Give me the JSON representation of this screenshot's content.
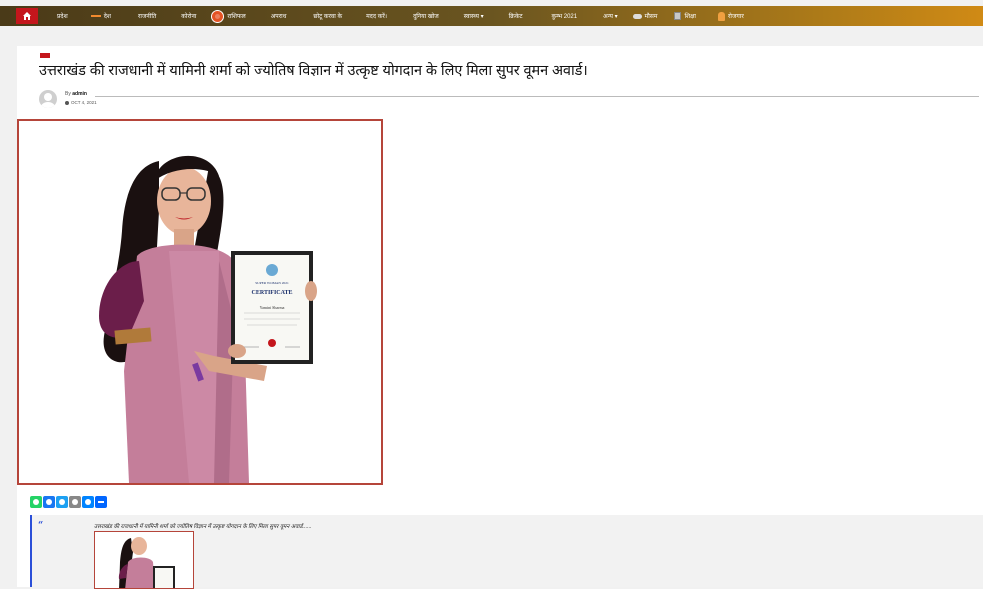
{
  "nav": {
    "home_icon": "home-icon",
    "items": [
      {
        "label": "प्रदेश",
        "icon": ""
      },
      {
        "label": "देश",
        "icon": "line"
      },
      {
        "label": "राजनीति",
        "icon": ""
      },
      {
        "label": "कोरोना",
        "icon": ""
      },
      {
        "label": "राशिफल",
        "icon": "zodiac-icon"
      },
      {
        "label": "अपराध",
        "icon": ""
      },
      {
        "label": "छोटू करवा के",
        "icon": ""
      },
      {
        "label": "मदद करें।",
        "icon": ""
      },
      {
        "label": "दुनिया खोज",
        "icon": ""
      },
      {
        "label": "स्वास्थ्य ▾",
        "icon": ""
      },
      {
        "label": "क्रिकेट",
        "icon": ""
      },
      {
        "label": "कुम्भ 2021",
        "icon": ""
      },
      {
        "label": "अन्य ▾",
        "icon": ""
      },
      {
        "label": "मौसम",
        "icon": "cloud-icon"
      },
      {
        "label": "शिक्षा",
        "icon": "book-icon"
      },
      {
        "label": "रोजगार",
        "icon": "person-icon"
      }
    ]
  },
  "article": {
    "title": "उत्तराखंड की राजधानी में यामिनी शर्मा को ज्योतिष विज्ञान में उत्कृष्ट योगदान के लिए मिला सुपर वूमन अवार्ड।",
    "by_label": "By",
    "author": "admin",
    "date": "OCT 4, 2021"
  },
  "certificate": {
    "header": "SUPER WOMAN 2021",
    "title": "CERTIFICATE",
    "name": "Yamini Sharma"
  },
  "share": {
    "buttons": [
      {
        "name": "whatsapp",
        "color": "#25d366"
      },
      {
        "name": "facebook",
        "color": "#1877f2"
      },
      {
        "name": "twitter",
        "color": "#1da1f2"
      },
      {
        "name": "email",
        "color": "#888888"
      },
      {
        "name": "messenger",
        "color": "#0084ff"
      },
      {
        "name": "share",
        "color": "#0166ff"
      }
    ]
  },
  "quote": {
    "mark": "“",
    "text": "उत्तराखंड की राजधानी में यामिनी शर्मा को ज्योतिष विज्ञान में उत्कृष्ट योगदान के लिए मिला सुपर वूमन अवार्ड......"
  }
}
